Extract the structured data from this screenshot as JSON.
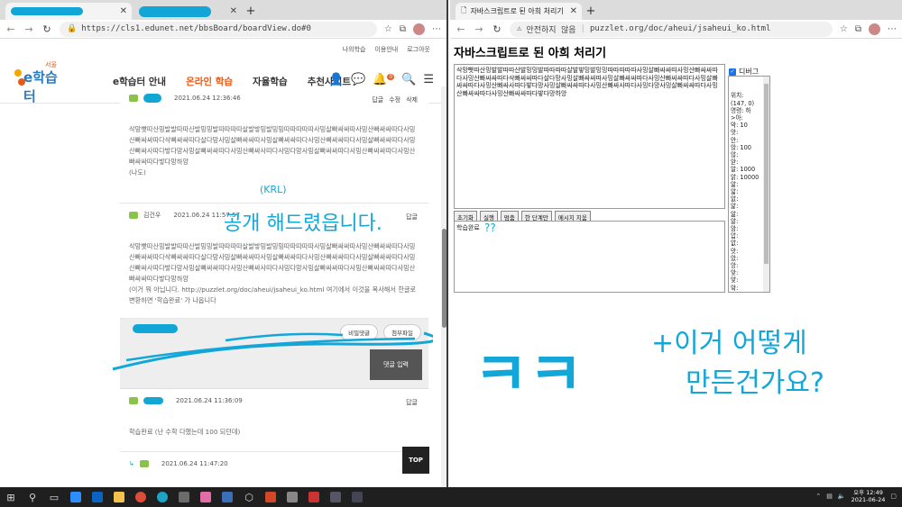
{
  "left": {
    "tab_active": "",
    "tab_inactive": "",
    "url": "https://cls1.edunet.net/bbsBoard/boardView.do#0",
    "site": {
      "toplinks": [
        "나의학습",
        "이용안내",
        "로그아웃"
      ],
      "logo_text": "e학습터",
      "logo_small": "서울",
      "menu": [
        "e학습터 안내",
        "온라인 학습",
        "자율학습",
        "추천사이트"
      ],
      "notif_count": "0"
    },
    "comments": [
      {
        "author": "",
        "date": "2021.06.24 12:36:46",
        "actions": [
          "답글",
          "수정",
          "삭제"
        ],
        "body": "삭망빳따산밍발발따따산발밍밍발따따따따살발밯밍발밍밍따따따따따사밍살빠싸싸따사밍산빠싸싸따다사밍산빠싸싸따다삭빠싸싸따다살다망사밍살빠싸싸따사밍살빠싸싸따다사밍산빠싸싸따다사밍살빠싸싸따다사밍산빠싸사따다밯다망사밍살빠싸싸따다사밍산빠싸사따다사밍다망사밍살빠싸싸따다사밍산빠싸싸따다사밍산빠싸싸따다밯다망하앙",
        "extra": "(나도)"
      },
      {
        "author": "김건우",
        "date": "2021.06.24 11:57:57",
        "actions": [
          "답글"
        ],
        "body": "삭망빳따산밍발발따따산발밍밍발따따따따살발밯밍발밍밍따따따따따사밍살빠싸싸따사밍산빠싸싸따다사밍산빠싸싸따다삭빠싸싸따다살다망사밍살빠싸싸따사밍살빠싸싸따다사밍산빠싸싸따다사밍살빠싸싸따다사밍산빠싸사따다밯다망사밍살빠싸싸따다사밍산빠싸사따다사밍다망사밍살빠싸싸따다사밍산빠싸싸따다사밍산빠싸싸따다밯다망하앙",
        "extra": "(이거 뭐 아닙니다. http://puzzlet.org/doc/aheui/jsaheui_ko.html 여기에서 이것을 복사해서 한글로 변환하면 '학습완료' 가 나옵니다"
      }
    ],
    "write": {
      "secret": "비밀댓글",
      "attach": "첨부파일",
      "submit": "댓글 입력"
    },
    "comment3": {
      "date": "2021.06.24 11:36:09",
      "action": "답글",
      "body": "학습완료 (난 수학 다했는데 100 되던데)"
    },
    "comment4": {
      "date": "2021.06.24 11:47:20"
    },
    "top_btn": "TOP"
  },
  "right": {
    "tab": "자바스크립트로 된 아희 처리기",
    "security": "안전하지 않음",
    "url": "puzzlet.org/doc/aheui/jsaheui_ko.html",
    "title": "자바스크립트로 된 아희 처리기",
    "code": "삭망빳따산밍발발따따산발밍밍발따따따따살발밯밍발밍밍따따따따따사밍살빠싸싸따사밍산빠싸싸따다사밍산빠싸싸따다삭빠싸싸따다살다망사밍살빠싸싸따사밍살빠싸싸따다사밍산빠싸싸따다사밍살빠싸싸따다사밍산빠싸사따다밯다망사밍살빠싸싸따다사밍산빠싸사따다사밍다망사밍살빠싸싸따다사밍산빠싸싸따다사밍산빠싸싸따다밯다망하앙",
    "buttons": [
      "초기화",
      "실행",
      "멈춤",
      "한 단계만",
      "메시지 지움"
    ],
    "output": "학습완료",
    "debug_label": "디버그",
    "debug_text": "위치:\n(147, 0)\n명령: 하\n>아:\n악: 10\n앗:\n안:\n앉: 100\n않:\n앋:\n알: 1000\n앍: 10000\n앎:\n앏:\n앐:\n앑:\n앒:\n앓:\n암:\n압:\n앖:\n앗:\n았:\n앙:\n앚:\n앛:\n앜:\n앝:\n앞:\n앟:"
  },
  "handwriting": {
    "krl": "(KRL)",
    "share": "공개 해드렸읍니다.",
    "q": "??",
    "kk": "ㅋㅋ",
    "note1": "+이거 어떻게",
    "note2": "만든건가요?"
  },
  "taskbar": {
    "time": "오후 12:49",
    "date": "2021-06-24"
  }
}
